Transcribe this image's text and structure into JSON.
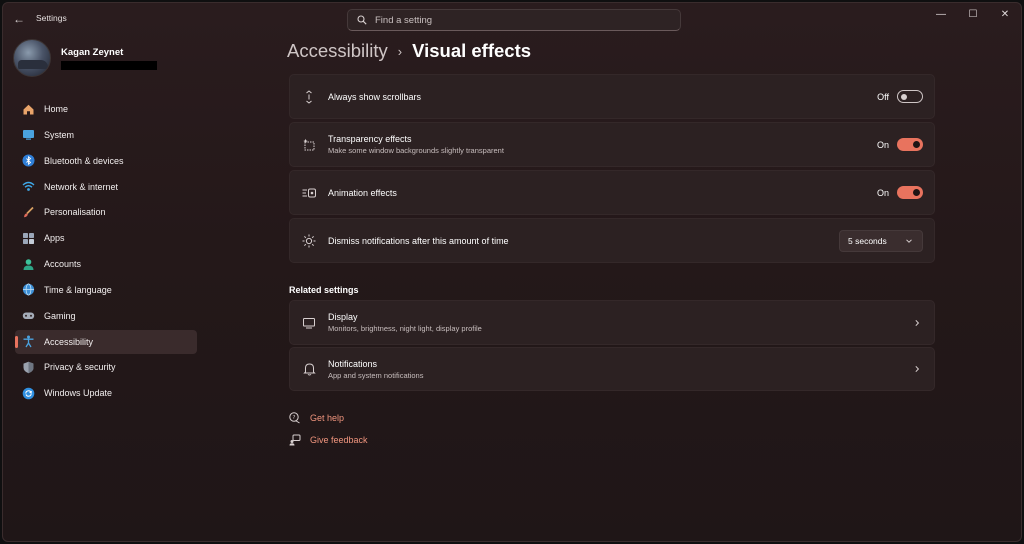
{
  "window": {
    "title": "Settings",
    "back_glyph": "←",
    "controls": {
      "minimize": "—",
      "maximize": "☐",
      "close": "✕"
    }
  },
  "search": {
    "placeholder": "Find a setting",
    "value": ""
  },
  "profile": {
    "name": "Kagan Zeynet"
  },
  "sidebar": {
    "items": [
      {
        "label": "Home",
        "icon": "home-icon"
      },
      {
        "label": "System",
        "icon": "system-icon"
      },
      {
        "label": "Bluetooth & devices",
        "icon": "bluetooth-icon"
      },
      {
        "label": "Network & internet",
        "icon": "network-icon"
      },
      {
        "label": "Personalisation",
        "icon": "brush-icon"
      },
      {
        "label": "Apps",
        "icon": "apps-icon"
      },
      {
        "label": "Accounts",
        "icon": "accounts-icon"
      },
      {
        "label": "Time & language",
        "icon": "globe-icon"
      },
      {
        "label": "Gaming",
        "icon": "gamepad-icon"
      },
      {
        "label": "Accessibility",
        "icon": "accessibility-icon",
        "active": true
      },
      {
        "label": "Privacy & security",
        "icon": "shield-icon"
      },
      {
        "label": "Windows Update",
        "icon": "update-icon"
      }
    ]
  },
  "breadcrumb": {
    "parent": "Accessibility",
    "separator": "›",
    "current": "Visual effects"
  },
  "settings": {
    "scrollbars": {
      "title": "Always show scrollbars",
      "state": "Off",
      "on": false
    },
    "transparency": {
      "title": "Transparency effects",
      "subtitle": "Make some window backgrounds slightly transparent",
      "state": "On",
      "on": true
    },
    "animation": {
      "title": "Animation effects",
      "state": "On",
      "on": true
    },
    "dismiss": {
      "title": "Dismiss notifications after this amount of time",
      "value": "5 seconds"
    }
  },
  "related": {
    "heading": "Related settings",
    "display": {
      "title": "Display",
      "subtitle": "Monitors, brightness, night light, display profile"
    },
    "notifications": {
      "title": "Notifications",
      "subtitle": "App and system notifications"
    }
  },
  "links": {
    "help": "Get help",
    "feedback": "Give feedback"
  },
  "colors": {
    "accent": "#e8735e",
    "link": "#f0957e",
    "card": "#2c2122",
    "background": "#241819"
  }
}
